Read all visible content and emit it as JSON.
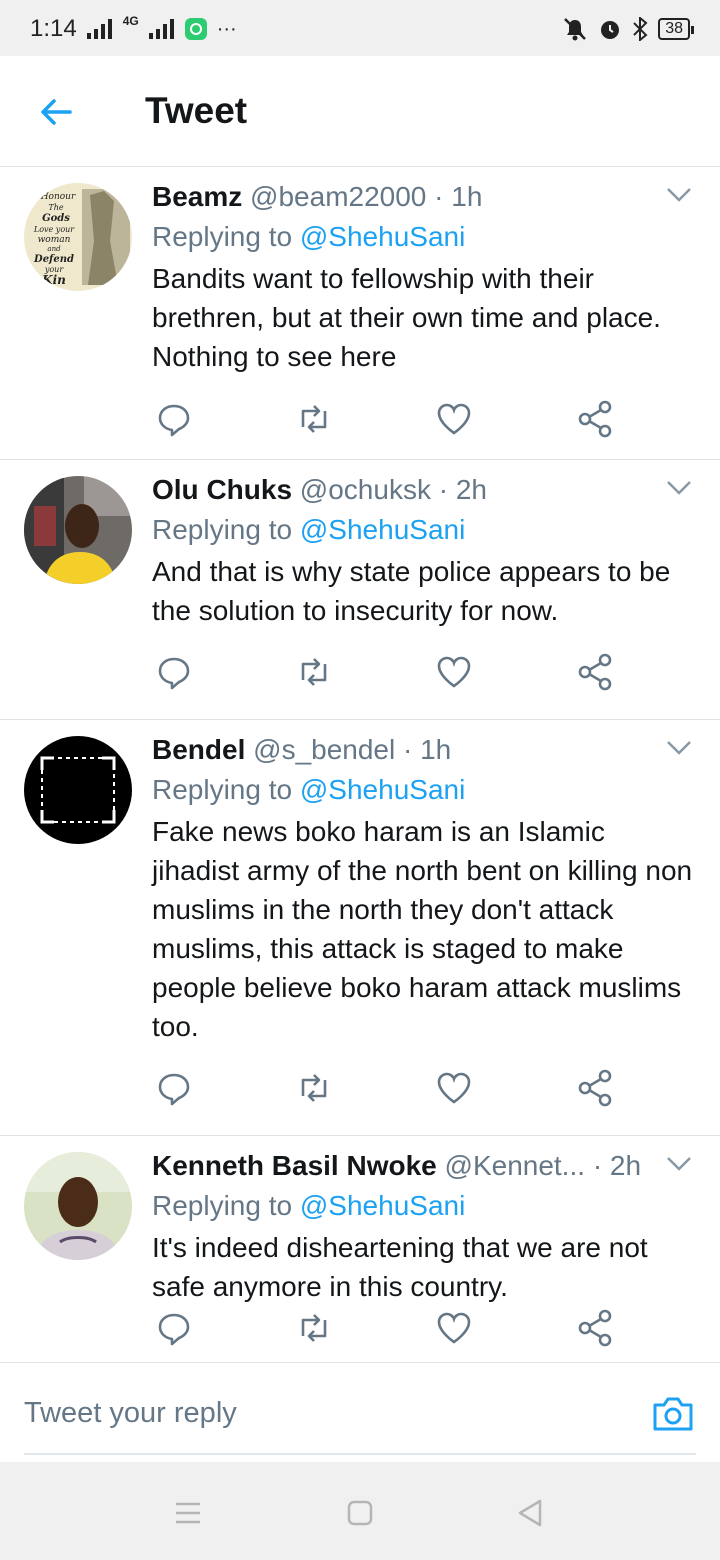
{
  "status_bar": {
    "time": "1:14",
    "network": "4G",
    "battery": "38"
  },
  "header": {
    "title": "Tweet"
  },
  "tweets": [
    {
      "name": "Beamz",
      "handle": "@beam22000",
      "time": "· 1h",
      "reply_prefix": "Replying to",
      "reply_to": "@ShehuSani",
      "text": "Bandits want to fellowship with their brethren, but at their own time and place. Nothing to see here"
    },
    {
      "name": "Olu Chuks",
      "handle": "@ochuksk",
      "time": "· 2h",
      "reply_prefix": "Replying to",
      "reply_to": "@ShehuSani",
      "text": "And that is why state police appears to be the solution to insecurity for now."
    },
    {
      "name": "Bendel",
      "handle": "@s_bendel",
      "time": "· 1h",
      "reply_prefix": "Replying to",
      "reply_to": "@ShehuSani",
      "text": "Fake news boko haram is an Islamic jihadist army of the north bent on killing non muslims in the north they don't attack muslims, this attack is staged to make people believe boko haram attack muslims too."
    },
    {
      "name": "Kenneth Basil Nwoke",
      "handle": "@Kennet...",
      "time": "· 2h",
      "reply_prefix": "Replying to",
      "reply_to": "@ShehuSani",
      "text": "It's indeed disheartening that we are not safe anymore in this country."
    }
  ],
  "avatar_art": {
    "beamz_lines": [
      "Honour",
      "The",
      "Gods",
      "Love your",
      "woman",
      "and",
      "Defend",
      "your",
      "Kin"
    ]
  },
  "composer": {
    "placeholder": "Tweet your reply"
  },
  "icons": [
    "back-arrow-icon",
    "chevron-down-icon",
    "reply-icon",
    "retweet-icon",
    "like-icon",
    "share-icon",
    "camera-icon"
  ],
  "colors": {
    "accent": "#1da1f2",
    "text": "#14171a",
    "muted": "#657786",
    "divider": "#dfe3e6"
  }
}
